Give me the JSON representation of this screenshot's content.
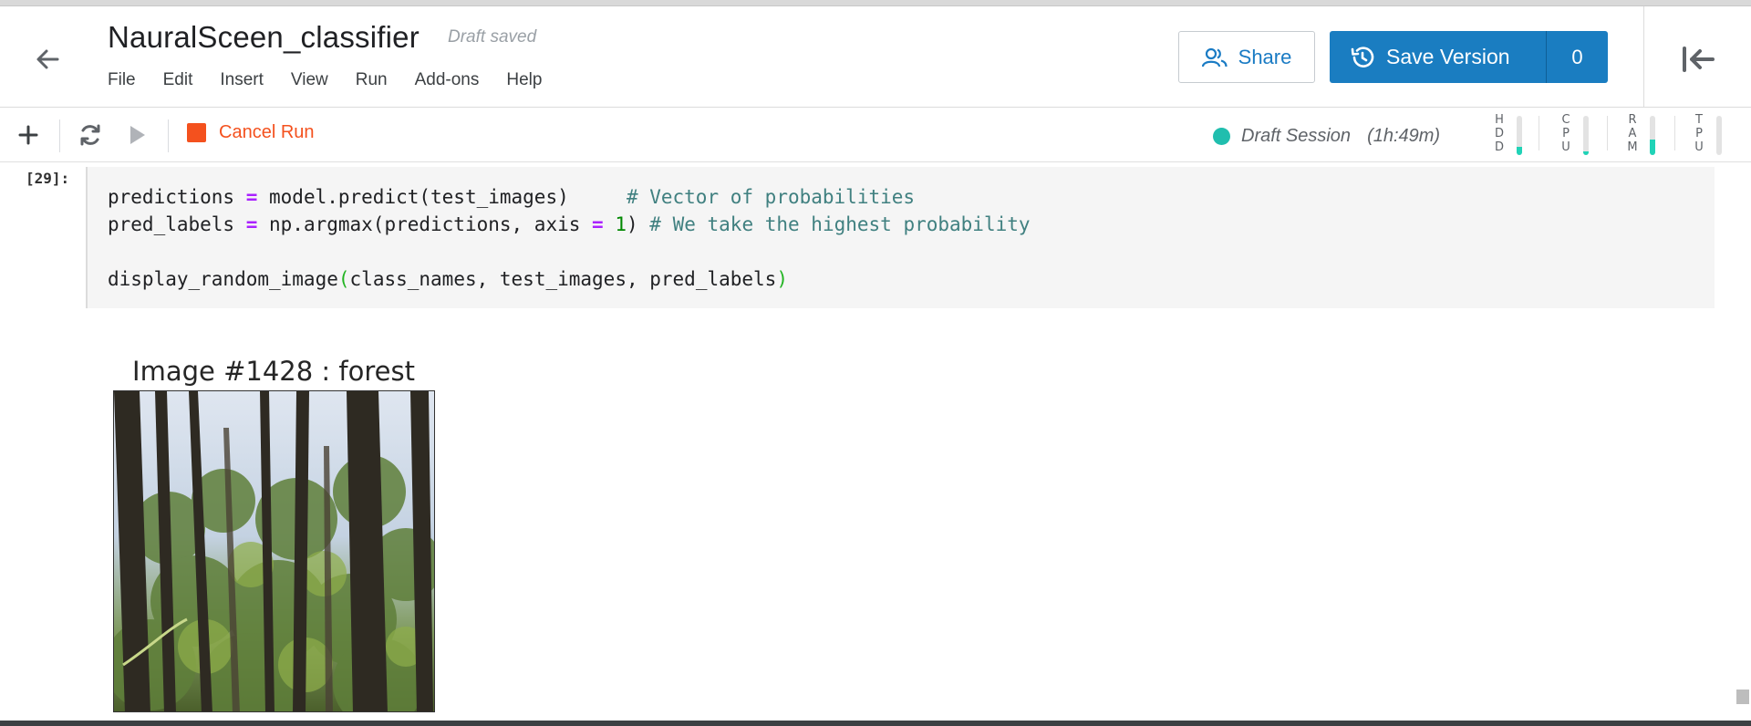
{
  "notebook": {
    "title": "NauralSceen_classifier",
    "status": "Draft saved"
  },
  "menu": {
    "items": [
      {
        "label": "File"
      },
      {
        "label": "Edit"
      },
      {
        "label": "Insert"
      },
      {
        "label": "View"
      },
      {
        "label": "Run"
      },
      {
        "label": "Add-ons"
      },
      {
        "label": "Help"
      }
    ]
  },
  "header": {
    "share_label": "Share",
    "save_label": "Save Version",
    "save_count": "0",
    "icons": [
      "back-arrow-icon",
      "share-people-icon",
      "history-icon",
      "collapse-panel-icon"
    ]
  },
  "toolbar": {
    "cancel_label": "Cancel Run",
    "icons": [
      "plus-icon",
      "refresh-icon",
      "play-icon",
      "stop-icon"
    ],
    "session_label": "Draft Session",
    "session_time": "(1h:49m)",
    "meters": [
      {
        "label": "HDD",
        "level": 0.2
      },
      {
        "label": "CPU",
        "level": 0.1
      },
      {
        "label": "RAM",
        "level": 0.4
      },
      {
        "label": "TPU",
        "level": 0.0
      }
    ],
    "accent_color": "#20d3b7",
    "stop_color": "#f4511e"
  },
  "cell": {
    "prompt": "[29]:",
    "lines": [
      {
        "parts": [
          {
            "t": "predictions ",
            "c": ""
          },
          {
            "t": "=",
            "c": "op"
          },
          {
            "t": " model.predict(test_images)     ",
            "c": ""
          },
          {
            "t": "# Vector of probabilities",
            "c": "cm"
          }
        ]
      },
      {
        "parts": [
          {
            "t": "pred_labels ",
            "c": ""
          },
          {
            "t": "=",
            "c": "op"
          },
          {
            "t": " np.argmax(predictions, axis ",
            "c": ""
          },
          {
            "t": "=",
            "c": "op"
          },
          {
            "t": " ",
            "c": ""
          },
          {
            "t": "1",
            "c": "num"
          },
          {
            "t": ") ",
            "c": ""
          },
          {
            "t": "# We take the highest probability",
            "c": "cm"
          }
        ]
      },
      {
        "parts": []
      },
      {
        "parts": [
          {
            "t": "display_random_image",
            "c": ""
          },
          {
            "t": "(",
            "c": "paren"
          },
          {
            "t": "class_names, test_images, pred_labels",
            "c": ""
          },
          {
            "t": ")",
            "c": "paren"
          }
        ]
      }
    ]
  },
  "output": {
    "figure_title": "Image #1428 : forest",
    "image_description": "forest-photo"
  },
  "colors": {
    "brand_blue": "#1a7dc1",
    "keyword_purple": "#aa22ff",
    "comment_teal": "#408080",
    "number_green": "#008800"
  }
}
